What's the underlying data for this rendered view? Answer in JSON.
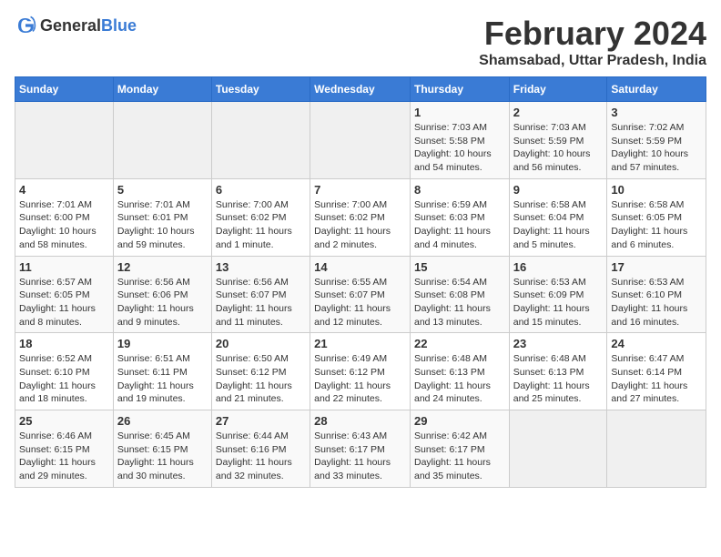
{
  "header": {
    "logo_general": "General",
    "logo_blue": "Blue",
    "title": "February 2024",
    "subtitle": "Shamsabad, Uttar Pradesh, India"
  },
  "weekdays": [
    "Sunday",
    "Monday",
    "Tuesday",
    "Wednesday",
    "Thursday",
    "Friday",
    "Saturday"
  ],
  "weeks": [
    [
      {
        "day": "",
        "info": ""
      },
      {
        "day": "",
        "info": ""
      },
      {
        "day": "",
        "info": ""
      },
      {
        "day": "",
        "info": ""
      },
      {
        "day": "1",
        "info": "Sunrise: 7:03 AM\nSunset: 5:58 PM\nDaylight: 10 hours and 54 minutes."
      },
      {
        "day": "2",
        "info": "Sunrise: 7:03 AM\nSunset: 5:59 PM\nDaylight: 10 hours and 56 minutes."
      },
      {
        "day": "3",
        "info": "Sunrise: 7:02 AM\nSunset: 5:59 PM\nDaylight: 10 hours and 57 minutes."
      }
    ],
    [
      {
        "day": "4",
        "info": "Sunrise: 7:01 AM\nSunset: 6:00 PM\nDaylight: 10 hours and 58 minutes."
      },
      {
        "day": "5",
        "info": "Sunrise: 7:01 AM\nSunset: 6:01 PM\nDaylight: 10 hours and 59 minutes."
      },
      {
        "day": "6",
        "info": "Sunrise: 7:00 AM\nSunset: 6:02 PM\nDaylight: 11 hours and 1 minute."
      },
      {
        "day": "7",
        "info": "Sunrise: 7:00 AM\nSunset: 6:02 PM\nDaylight: 11 hours and 2 minutes."
      },
      {
        "day": "8",
        "info": "Sunrise: 6:59 AM\nSunset: 6:03 PM\nDaylight: 11 hours and 4 minutes."
      },
      {
        "day": "9",
        "info": "Sunrise: 6:58 AM\nSunset: 6:04 PM\nDaylight: 11 hours and 5 minutes."
      },
      {
        "day": "10",
        "info": "Sunrise: 6:58 AM\nSunset: 6:05 PM\nDaylight: 11 hours and 6 minutes."
      }
    ],
    [
      {
        "day": "11",
        "info": "Sunrise: 6:57 AM\nSunset: 6:05 PM\nDaylight: 11 hours and 8 minutes."
      },
      {
        "day": "12",
        "info": "Sunrise: 6:56 AM\nSunset: 6:06 PM\nDaylight: 11 hours and 9 minutes."
      },
      {
        "day": "13",
        "info": "Sunrise: 6:56 AM\nSunset: 6:07 PM\nDaylight: 11 hours and 11 minutes."
      },
      {
        "day": "14",
        "info": "Sunrise: 6:55 AM\nSunset: 6:07 PM\nDaylight: 11 hours and 12 minutes."
      },
      {
        "day": "15",
        "info": "Sunrise: 6:54 AM\nSunset: 6:08 PM\nDaylight: 11 hours and 13 minutes."
      },
      {
        "day": "16",
        "info": "Sunrise: 6:53 AM\nSunset: 6:09 PM\nDaylight: 11 hours and 15 minutes."
      },
      {
        "day": "17",
        "info": "Sunrise: 6:53 AM\nSunset: 6:10 PM\nDaylight: 11 hours and 16 minutes."
      }
    ],
    [
      {
        "day": "18",
        "info": "Sunrise: 6:52 AM\nSunset: 6:10 PM\nDaylight: 11 hours and 18 minutes."
      },
      {
        "day": "19",
        "info": "Sunrise: 6:51 AM\nSunset: 6:11 PM\nDaylight: 11 hours and 19 minutes."
      },
      {
        "day": "20",
        "info": "Sunrise: 6:50 AM\nSunset: 6:12 PM\nDaylight: 11 hours and 21 minutes."
      },
      {
        "day": "21",
        "info": "Sunrise: 6:49 AM\nSunset: 6:12 PM\nDaylight: 11 hours and 22 minutes."
      },
      {
        "day": "22",
        "info": "Sunrise: 6:48 AM\nSunset: 6:13 PM\nDaylight: 11 hours and 24 minutes."
      },
      {
        "day": "23",
        "info": "Sunrise: 6:48 AM\nSunset: 6:13 PM\nDaylight: 11 hours and 25 minutes."
      },
      {
        "day": "24",
        "info": "Sunrise: 6:47 AM\nSunset: 6:14 PM\nDaylight: 11 hours and 27 minutes."
      }
    ],
    [
      {
        "day": "25",
        "info": "Sunrise: 6:46 AM\nSunset: 6:15 PM\nDaylight: 11 hours and 29 minutes."
      },
      {
        "day": "26",
        "info": "Sunrise: 6:45 AM\nSunset: 6:15 PM\nDaylight: 11 hours and 30 minutes."
      },
      {
        "day": "27",
        "info": "Sunrise: 6:44 AM\nSunset: 6:16 PM\nDaylight: 11 hours and 32 minutes."
      },
      {
        "day": "28",
        "info": "Sunrise: 6:43 AM\nSunset: 6:17 PM\nDaylight: 11 hours and 33 minutes."
      },
      {
        "day": "29",
        "info": "Sunrise: 6:42 AM\nSunset: 6:17 PM\nDaylight: 11 hours and 35 minutes."
      },
      {
        "day": "",
        "info": ""
      },
      {
        "day": "",
        "info": ""
      }
    ]
  ]
}
